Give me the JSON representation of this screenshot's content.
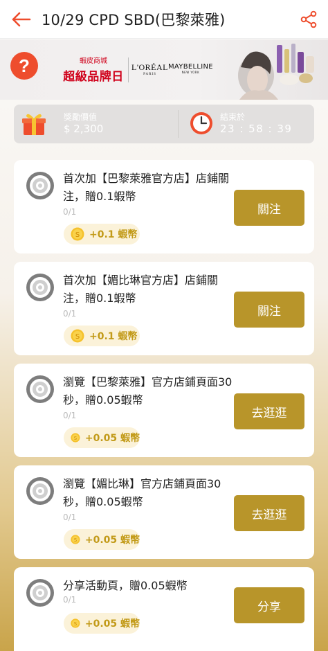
{
  "header": {
    "title": "10/29 CPD SBD(巴黎萊雅)",
    "back_icon": "back-arrow-icon",
    "share_icon": "share-icon",
    "accent_color": "#ee4d2d"
  },
  "banner": {
    "help_symbol": "?",
    "mall_label": "蝦皮商城",
    "brand_day": "超級品牌日",
    "loreal": "L'ORÉAL",
    "loreal_sub": "PARIS",
    "maybelline": "MAYBELLINE",
    "maybelline_sub": "NEW YORK"
  },
  "reward": {
    "label": "獎勵價值",
    "value": "$ 2,300",
    "end_label": "結束於",
    "countdown": "23 : 58 : 39"
  },
  "tasks": [
    {
      "text": "首次加【巴黎萊雅官方店】店鋪關注，贈0.1蝦幣",
      "progress": "0/1",
      "reward": "+0.1 蝦幣",
      "button": "關注"
    },
    {
      "text": "首次加【媚比琳官方店】店鋪關注，贈0.1蝦幣",
      "progress": "0/1",
      "reward": "+0.1 蝦幣",
      "button": "關注"
    },
    {
      "text": "瀏覽【巴黎萊雅】官方店鋪頁面30秒，贈0.05蝦幣",
      "progress": "0/1",
      "reward": "+0.05 蝦幣",
      "button": "去逛逛"
    },
    {
      "text": "瀏覽【媚比琳】官方店鋪頁面30秒，贈0.05蝦幣",
      "progress": "0/1",
      "reward": "+0.05 蝦幣",
      "button": "去逛逛"
    },
    {
      "text": "分享活動頁，贈0.05蝦幣",
      "progress": "0/1",
      "reward": "+0.05 蝦幣",
      "button": "分享"
    }
  ],
  "colors": {
    "button_gold": "#b8952a",
    "coin_gold": "#c29a18",
    "coin_badge_bg": "#fbf2d9"
  }
}
